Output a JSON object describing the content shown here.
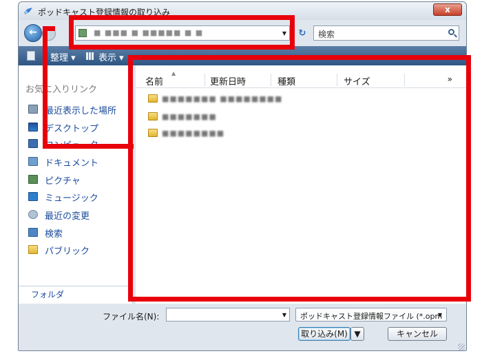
{
  "window": {
    "title": "ポッドキャスト登録情報の取り込み",
    "close": "x"
  },
  "nav": {
    "address": "■ ■■■ ■ ■■■■■ ■ ■",
    "search_placeholder": "検索"
  },
  "toolbar": {
    "organize": "整理 ▾",
    "view": "表示 ▾"
  },
  "sidebar": {
    "favorites_header": "お気に入りリンク",
    "items": [
      {
        "label": "最近表示した場所",
        "icon": "recent-places-icon"
      },
      {
        "label": "デスクトップ",
        "icon": "desktop-icon"
      },
      {
        "label": "コンピュータ",
        "icon": "computer-icon"
      },
      {
        "label": "ドキュメント",
        "icon": "documents-icon"
      },
      {
        "label": "ピクチャ",
        "icon": "pictures-icon"
      },
      {
        "label": "ミュージック",
        "icon": "music-icon"
      },
      {
        "label": "最近の変更",
        "icon": "recent-changes-icon"
      },
      {
        "label": "検索",
        "icon": "search-folder-icon"
      },
      {
        "label": "パブリック",
        "icon": "public-folder-icon"
      }
    ],
    "folders_label": "フォルダ"
  },
  "filelist": {
    "columns": [
      "名前",
      "更新日時",
      "種類",
      "サイズ"
    ],
    "more": "»",
    "rows": [
      {
        "name": "■■■■■■■ ■■■■■■■■"
      },
      {
        "name": "■■■■■■■"
      },
      {
        "name": "■■■■■■■■"
      }
    ]
  },
  "footer": {
    "filename_label": "ファイル名(N):",
    "filename_value": "",
    "filetype": "ポッドキャスト登録情報ファイル (*.opm",
    "open_button": "取り込み(M)",
    "cancel_button": "キャンセル"
  },
  "colors": {
    "highlight": "#e8000b",
    "toolbar": "#3f6592",
    "link": "#1a4a9a"
  }
}
